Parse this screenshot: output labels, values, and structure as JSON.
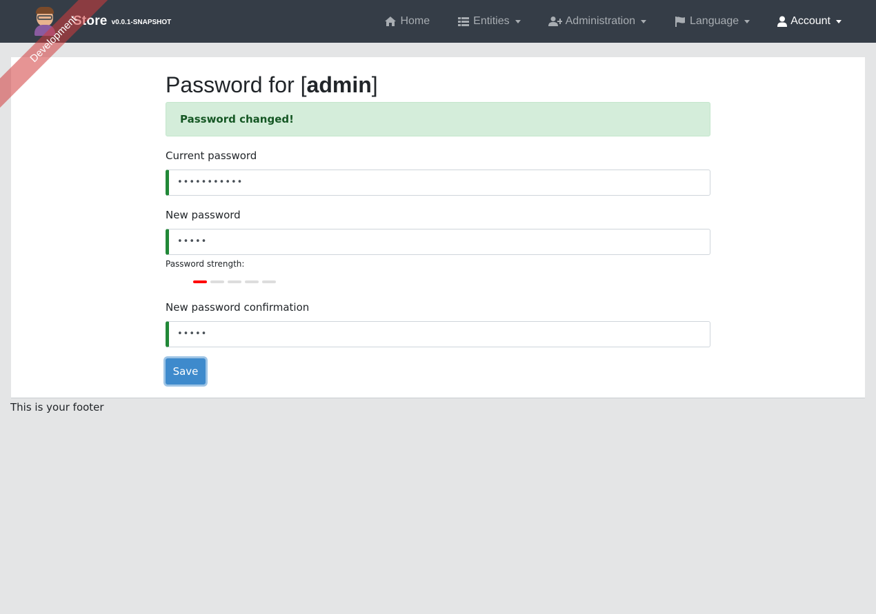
{
  "navbar": {
    "brand_title": "Store",
    "brand_version": "v0.0.1-SNAPSHOT",
    "ribbon": "Development",
    "items": [
      {
        "label": "Home",
        "icon": "home-icon"
      },
      {
        "label": "Entities",
        "icon": "table-list-icon"
      },
      {
        "label": "Administration",
        "icon": "user-plus-icon"
      },
      {
        "label": "Language",
        "icon": "flag-icon"
      },
      {
        "label": "Account",
        "icon": "user-icon"
      }
    ]
  },
  "page": {
    "title_prefix": "Password for [",
    "username": "admin",
    "title_suffix": "]",
    "alert": "Password changed!"
  },
  "form": {
    "current_password_label": "Current password",
    "current_password_value": "•••••••••••",
    "new_password_label": "New password",
    "new_password_value": "•••••",
    "strength_label": "Password strength:",
    "strength_level": 1,
    "strength_max": 5,
    "confirm_label": "New password confirmation",
    "confirm_value": "•••••",
    "save_label": "Save"
  },
  "footer": "This is your footer",
  "colors": {
    "navbar_bg": "#353d47",
    "success_border": "#218838",
    "primary": "#3e8acc",
    "strength_weak": "#ff0000"
  }
}
